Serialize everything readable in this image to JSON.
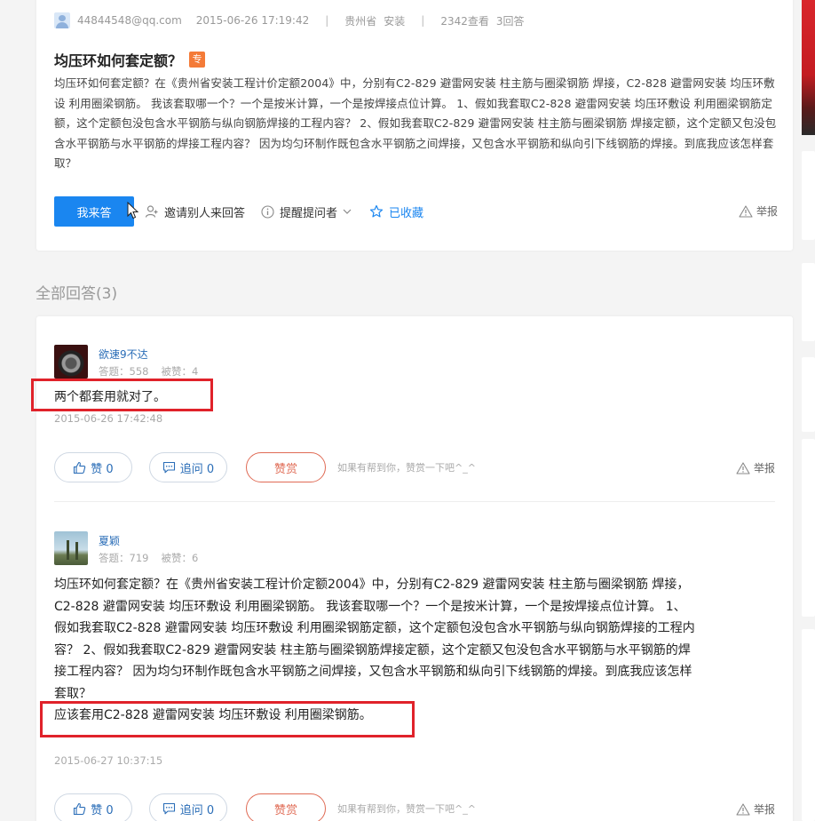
{
  "question": {
    "user": "44844548@qq.com",
    "datetime": "2015-06-26 17:19:42",
    "location": "贵州省",
    "category": "安装",
    "views": "2342查看",
    "answers_count": "3回答",
    "title": "均压环如何套定额？",
    "badge": "专",
    "body": "均压环如何套定额？在《贵州省安装工程计价定额2004》中，分别有C2-829 避雷网安装 柱主筋与圈梁钢筋 焊接，C2-828 避雷网安装 均压环敷设 利用圈梁钢筋。 我该套取哪一个？一个是按米计算，一个是按焊接点位计算。 1、假如我套取C2-828 避雷网安装 均压环敷设 利用圈梁钢筋定额，这个定额包没包含水平钢筋与纵向钢筋焊接的工程内容？ 2、假如我套取C2-829 避雷网安装 柱主筋与圈梁钢筋 焊接定额，这个定额又包没包含水平钢筋与水平钢筋的焊接工程内容？ 因为均匀环制作既包含水平钢筋之间焊接，又包含水平钢筋和纵向引下线钢筋的焊接。到底我应该怎样套取？",
    "actions": {
      "answer_button": "我来答",
      "invite": "邀请别人来回答",
      "remind": "提醒提问者",
      "saved": "已收藏",
      "report": "举报"
    }
  },
  "all_answers_label": "全部回答(3)",
  "answers": [
    {
      "user": "欲速9不达",
      "stats_answers": "答题：558",
      "stats_likes": "被赞：4",
      "text": "两个都套用就对了。",
      "date": "2015-06-26 17:42:48",
      "like": "赞 0",
      "follow": "追问  0",
      "reward": "赞赏",
      "hint": "如果有帮到你，赞赏一下吧^_^",
      "report": "举报"
    },
    {
      "user": "夏颖",
      "stats_answers": "答题：719",
      "stats_likes": "被赞：6",
      "text_part1": "均压环如何套定额？在《贵州省安装工程计价定额2004》中，分别有C2-829 避雷网安装 柱主筋与圈梁钢筋 焊接，C2-828 避雷网安装 均压环敷设 利用圈梁钢筋。 我该套取哪一个？一个是按米计算，一个是按焊接点位计算。 1、假如我套取C2-828 避雷网安装 均压环敷设 利用圈梁钢筋定额，这个定额包没包含水平钢筋与纵向钢筋焊接的工程内容？ 2、假如我套取C2-829 避雷网安装 柱主筋与圈梁钢筋焊接定额，这个定额又包没包含水平钢筋与水平钢筋的焊接工程内容？ 因为均匀环制作既包含水平钢筋之间焊接，又包含水平钢筋和纵向引下线钢筋的焊接。到底我应该怎样套取？",
      "text_part2": "应该套用C2-828 避雷网安装 均压环敷设 利用圈梁钢筋。",
      "date": "2015-06-27 10:37:15",
      "like": "赞 0",
      "follow": "追问  0",
      "reward": "赞赏",
      "hint": "如果有帮到你，赞赏一下吧^_^",
      "report": "举报"
    }
  ],
  "colors": {
    "accent_blue": "#1a86f0",
    "link_blue": "#2a6db7",
    "reward_red": "#e06b55",
    "highlight_red": "#e0222a",
    "badge_orange": "#f47b38"
  }
}
